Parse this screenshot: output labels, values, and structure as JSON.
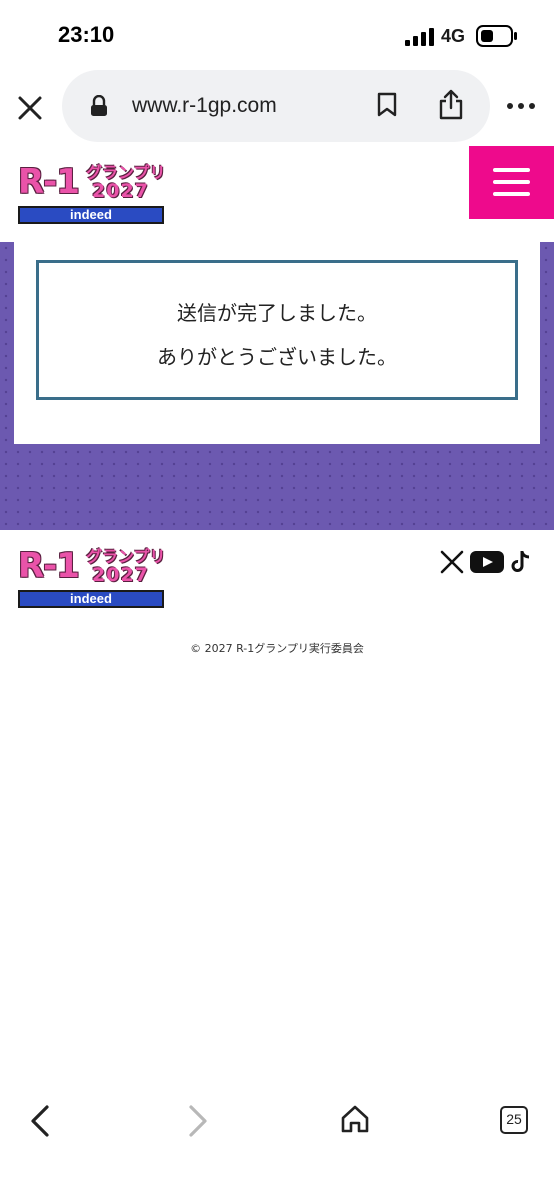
{
  "status_bar": {
    "time": "23:10",
    "network": "4G",
    "icons": [
      "signal-icon",
      "battery-icon"
    ]
  },
  "browser": {
    "url": "www.r-1gp.com",
    "icons": [
      "close-icon",
      "lock-icon",
      "bookmark-icon",
      "share-icon",
      "more-icon"
    ]
  },
  "site": {
    "logo": {
      "main": "R-1",
      "grand_prix": "グランプリ",
      "year": "2027",
      "sponsor": "indeed"
    },
    "menu_icon": "hamburger-icon",
    "colors": {
      "accent": "#ee0a8c",
      "section_bg": "#6c59b0",
      "box_border": "#3a6e8a"
    }
  },
  "message": {
    "line1": "送信が完了しました。",
    "line2": "ありがとうございました。"
  },
  "footer": {
    "social": [
      "x-icon",
      "youtube-icon",
      "tiktok-icon"
    ],
    "copyright": "© 2027 R-1グランプリ実行委員会"
  },
  "bottom_bar": {
    "tab_count": "25",
    "icons": [
      "back-icon",
      "forward-icon",
      "home-icon",
      "tabs-icon"
    ]
  }
}
